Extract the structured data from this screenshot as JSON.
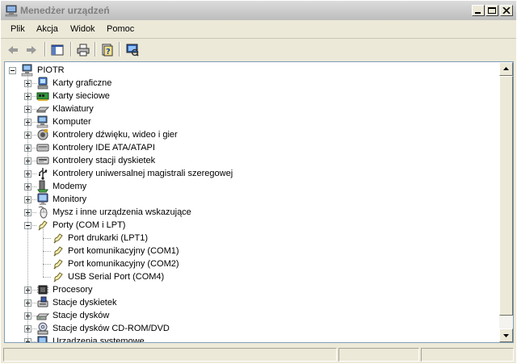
{
  "window": {
    "title": "Menedżer urządzeń"
  },
  "menu": [
    "Plik",
    "Akcja",
    "Widok",
    "Pomoc"
  ],
  "tree": {
    "root": "PIOTR",
    "categories": [
      {
        "label": "Karty graficzne",
        "icon": "display-adapter-icon",
        "expanded": false
      },
      {
        "label": "Karty sieciowe",
        "icon": "network-card-icon",
        "expanded": false
      },
      {
        "label": "Klawiatury",
        "icon": "keyboard-icon",
        "expanded": false
      },
      {
        "label": "Komputer",
        "icon": "computer-icon",
        "expanded": false
      },
      {
        "label": "Kontrolery dźwięku, wideo i gier",
        "icon": "sound-controller-icon",
        "expanded": false
      },
      {
        "label": "Kontrolery IDE ATA/ATAPI",
        "icon": "ide-controller-icon",
        "expanded": false
      },
      {
        "label": "Kontrolery stacji dyskietek",
        "icon": "floppy-controller-icon",
        "expanded": false
      },
      {
        "label": "Kontrolery uniwersalnej magistrali szeregowej",
        "icon": "usb-icon",
        "expanded": false
      },
      {
        "label": "Modemy",
        "icon": "modem-icon",
        "expanded": false
      },
      {
        "label": "Monitory",
        "icon": "monitor-icon",
        "expanded": false
      },
      {
        "label": "Mysz i inne urządzenia wskazujące",
        "icon": "mouse-icon",
        "expanded": false
      },
      {
        "label": "Porty (COM i LPT)",
        "icon": "port-icon",
        "expanded": true,
        "children": [
          "Port drukarki (LPT1)",
          "Port komunikacyjny (COM1)",
          "Port komunikacyjny (COM2)",
          "USB Serial Port (COM4)"
        ]
      },
      {
        "label": "Procesory",
        "icon": "processor-icon",
        "expanded": false
      },
      {
        "label": "Stacje dyskietek",
        "icon": "floppy-drive-icon",
        "expanded": false
      },
      {
        "label": "Stacje dysków",
        "icon": "disk-drive-icon",
        "expanded": false
      },
      {
        "label": "Stacje dysków CD-ROM/DVD",
        "icon": "cdrom-icon",
        "expanded": false
      },
      {
        "label": "Urządzenia systemowe",
        "icon": "system-device-icon",
        "expanded": false
      }
    ]
  }
}
